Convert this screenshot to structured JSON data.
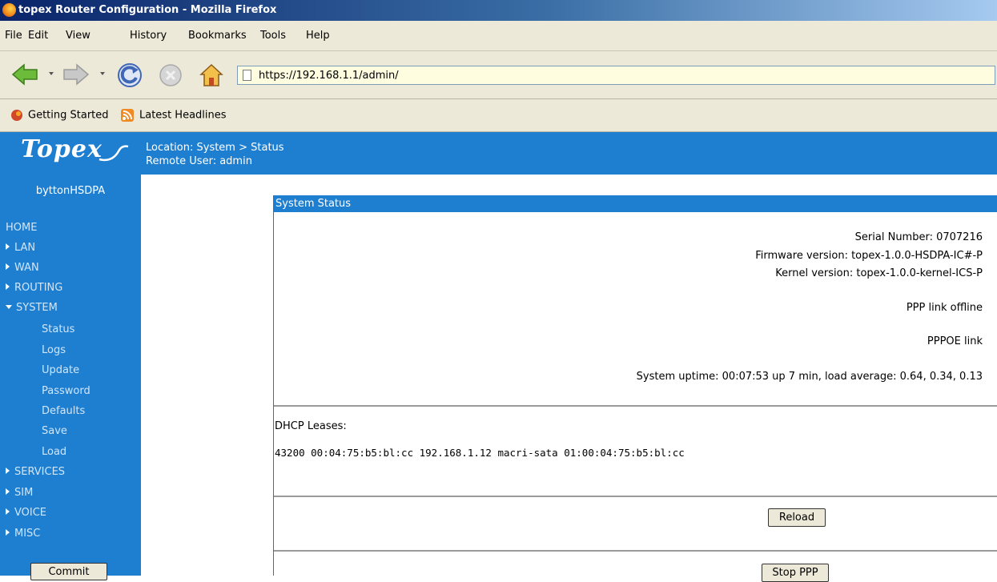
{
  "window": {
    "title": "topex Router Configuration - Mozilla Firefox"
  },
  "menubar": {
    "items": [
      "File",
      "Edit",
      "View",
      "History",
      "Bookmarks",
      "Tools",
      "Help"
    ]
  },
  "navbar": {
    "url": "https://192.168.1.1/admin/"
  },
  "bookmarks": {
    "items": [
      "Getting Started",
      "Latest Headlines"
    ]
  },
  "header": {
    "logo": "Topex",
    "location": "Location: System > Status",
    "remote_user": "Remote User: admin"
  },
  "sidebar": {
    "hostname": "byttonHSDPA",
    "items": [
      "HOME",
      "LAN",
      "WAN",
      "ROUTING",
      "SYSTEM",
      "Status",
      "Logs",
      "Update",
      "Password",
      "Defaults",
      "Save",
      "Load",
      "SERVICES",
      "SIM",
      "VOICE",
      "MISC"
    ],
    "commit_label": "Commit"
  },
  "panel": {
    "title": "System Status",
    "serial_number": "Serial Number: 0707216",
    "firmware_version": "Firmware version: topex-1.0.0-HSDPA-IC#-P",
    "kernel_version": "Kernel version: topex-1.0.0-kernel-ICS-P",
    "ppp_status": "PPP link offline",
    "pppoe_status": "PPPOE link",
    "uptime": "System uptime: 00:07:53 up 7 min, load average: 0.64, 0.34, 0.13",
    "dhcp_label": "DHCP Leases:",
    "dhcp_lease": "43200 00:04:75:b5:bl:cc 192.168.1.12 macri-sata 01:00:04:75:b5:bl:cc",
    "reload_label": "Reload",
    "stop_ppp_label": "Stop PPP"
  },
  "colors": {
    "brand_blue": "#1e7fd0",
    "chrome_bg": "#ece9d8",
    "url_bg": "#fffde0"
  }
}
